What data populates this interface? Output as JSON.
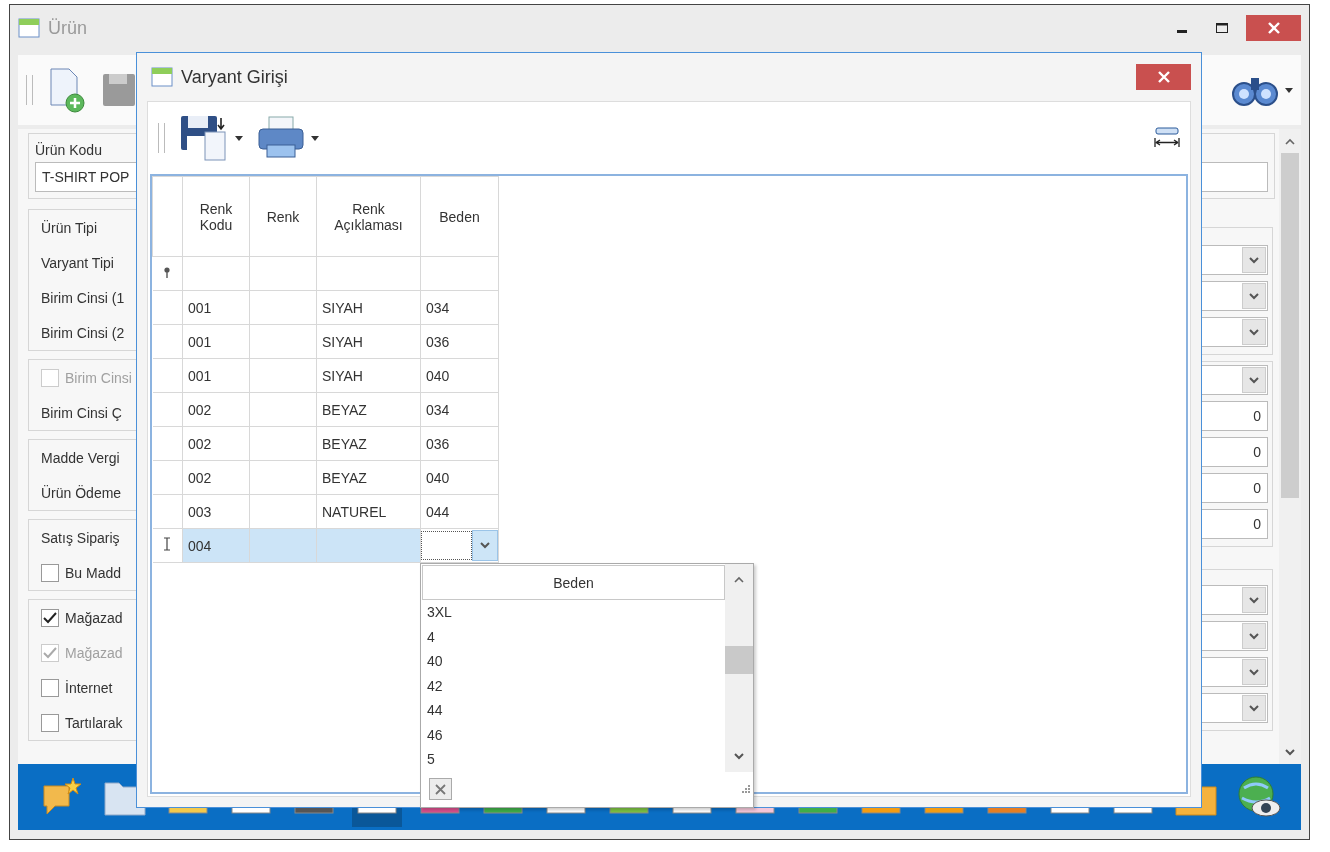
{
  "window": {
    "title": "Ürün"
  },
  "form": {
    "code_label": "Ürün Kodu",
    "code_value": "T-SHIRT POP",
    "left_groups": [
      {
        "items": [
          {
            "kind": "label",
            "text": "Ürün Tipi"
          },
          {
            "kind": "label",
            "text": "Varyant Tipi"
          },
          {
            "kind": "label",
            "text": "Birim Cinsi (1"
          },
          {
            "kind": "label",
            "text": "Birim Cinsi (2"
          }
        ]
      },
      {
        "items": [
          {
            "kind": "checkbox",
            "text": "Birim Cinsi",
            "checked": false,
            "disabled": true
          },
          {
            "kind": "label",
            "text": "Birim Cinsi Ç"
          }
        ]
      },
      {
        "items": [
          {
            "kind": "label",
            "text": "Madde Vergi"
          },
          {
            "kind": "label",
            "text": "Ürün Ödeme"
          }
        ]
      },
      {
        "items": [
          {
            "kind": "label",
            "text": "Satış Sipariş"
          },
          {
            "kind": "checkbox",
            "text": "Bu Madd",
            "checked": false,
            "disabled": false
          }
        ]
      },
      {
        "items": [
          {
            "kind": "checkbox",
            "text": "Mağazad",
            "checked": true,
            "disabled": false
          },
          {
            "kind": "checkbox",
            "text": "Mağazad",
            "checked": true,
            "disabled": true
          },
          {
            "kind": "checkbox",
            "text": "İnternet",
            "checked": false,
            "disabled": false
          },
          {
            "kind": "checkbox",
            "text": "Tartılarak",
            "checked": false,
            "disabled": false
          }
        ]
      }
    ],
    "right_groups": [
      {
        "items": [
          {
            "kind": "dropdown"
          },
          {
            "kind": "dropdown"
          },
          {
            "kind": "dropdown"
          }
        ]
      },
      {
        "items": [
          {
            "kind": "dropdown"
          },
          {
            "kind": "number",
            "value": "0"
          },
          {
            "kind": "number",
            "value": "0"
          },
          {
            "kind": "number",
            "value": "0"
          },
          {
            "kind": "number",
            "value": "0"
          }
        ]
      },
      {
        "items": [
          {
            "kind": "dropdown"
          },
          {
            "kind": "dropdown"
          },
          {
            "kind": "dropdown"
          },
          {
            "kind": "dropdown"
          }
        ]
      }
    ]
  },
  "dialog": {
    "title": "Varyant Girişi",
    "columns": [
      "Renk Kodu",
      "Renk",
      "Renk Açıklaması",
      "Beden"
    ],
    "rows": [
      {
        "code": "001",
        "description": "SIYAH",
        "size": "034",
        "selected": false
      },
      {
        "code": "001",
        "description": "SIYAH",
        "size": "036",
        "selected": false
      },
      {
        "code": "001",
        "description": "SIYAH",
        "size": "040",
        "selected": false
      },
      {
        "code": "002",
        "description": "BEYAZ",
        "size": "034",
        "selected": false
      },
      {
        "code": "002",
        "description": "BEYAZ",
        "size": "036",
        "selected": false
      },
      {
        "code": "002",
        "description": "BEYAZ",
        "size": "040",
        "selected": false
      },
      {
        "code": "003",
        "description": "NATUREL",
        "size": "044",
        "selected": false
      },
      {
        "code": "004",
        "selected": true
      }
    ],
    "dropdown": {
      "header": "Beden",
      "items": [
        "3XL",
        "4",
        "40",
        "42",
        "44",
        "46",
        "5"
      ]
    }
  },
  "taskbar": {
    "items": [
      {
        "kind": "chat",
        "selected": false
      },
      {
        "kind": "folder",
        "selected": false
      },
      {
        "kind": "tile",
        "selected": false
      },
      {
        "kind": "tile",
        "selected": false
      },
      {
        "kind": "tile",
        "selected": false
      },
      {
        "kind": "tile",
        "selected": true
      },
      {
        "kind": "tile",
        "selected": false
      },
      {
        "kind": "tile",
        "selected": false
      },
      {
        "kind": "tile",
        "selected": false
      },
      {
        "kind": "tile",
        "selected": false
      },
      {
        "kind": "tile",
        "selected": false
      },
      {
        "kind": "tile",
        "selected": false
      },
      {
        "kind": "tile",
        "selected": false
      },
      {
        "kind": "tile",
        "selected": false
      },
      {
        "kind": "tile",
        "selected": false
      },
      {
        "kind": "tile",
        "selected": false
      },
      {
        "kind": "tile",
        "selected": false
      },
      {
        "kind": "tile",
        "selected": false
      },
      {
        "kind": "folder",
        "selected": false
      },
      {
        "kind": "globe",
        "selected": false
      }
    ]
  }
}
